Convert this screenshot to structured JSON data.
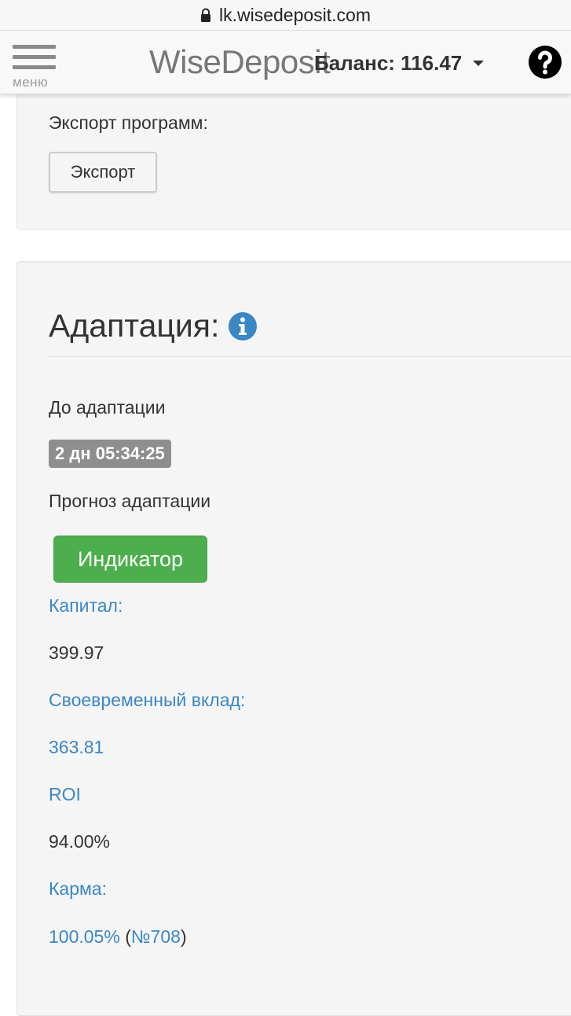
{
  "browser": {
    "url": "lk.wisedeposit.com"
  },
  "header": {
    "menu_label": "меню",
    "brand": "WiseDeposit",
    "balance": "Баланс: 116.47"
  },
  "export_panel": {
    "label": "Экспорт программ:",
    "button": "Экспорт"
  },
  "adaptation": {
    "title": "Адаптация:",
    "until_label": "До адаптации",
    "timer": "2 дн 05:34:25",
    "forecast_label": "Прогноз адаптации",
    "indicator_button": "Индикатор",
    "capital_label": "Капитал:",
    "capital_value": "399.97",
    "timely_deposit_label": "Своевременный вклад:",
    "timely_deposit_value": "363.81",
    "roi_label": "ROI",
    "roi_value": "94.00%",
    "karma_label": "Карма:",
    "karma_value": "100.05%",
    "karma_rank": "№708"
  },
  "colors": {
    "link": "#3a87c4",
    "success": "#4cae4c",
    "badge": "#8e8e8e",
    "info": "#3a87c4"
  },
  "icons": {
    "lock": "lock-icon",
    "menu": "hamburger-icon",
    "caret": "caret-down-icon",
    "help": "question-circle-icon",
    "info": "info-circle-icon"
  }
}
